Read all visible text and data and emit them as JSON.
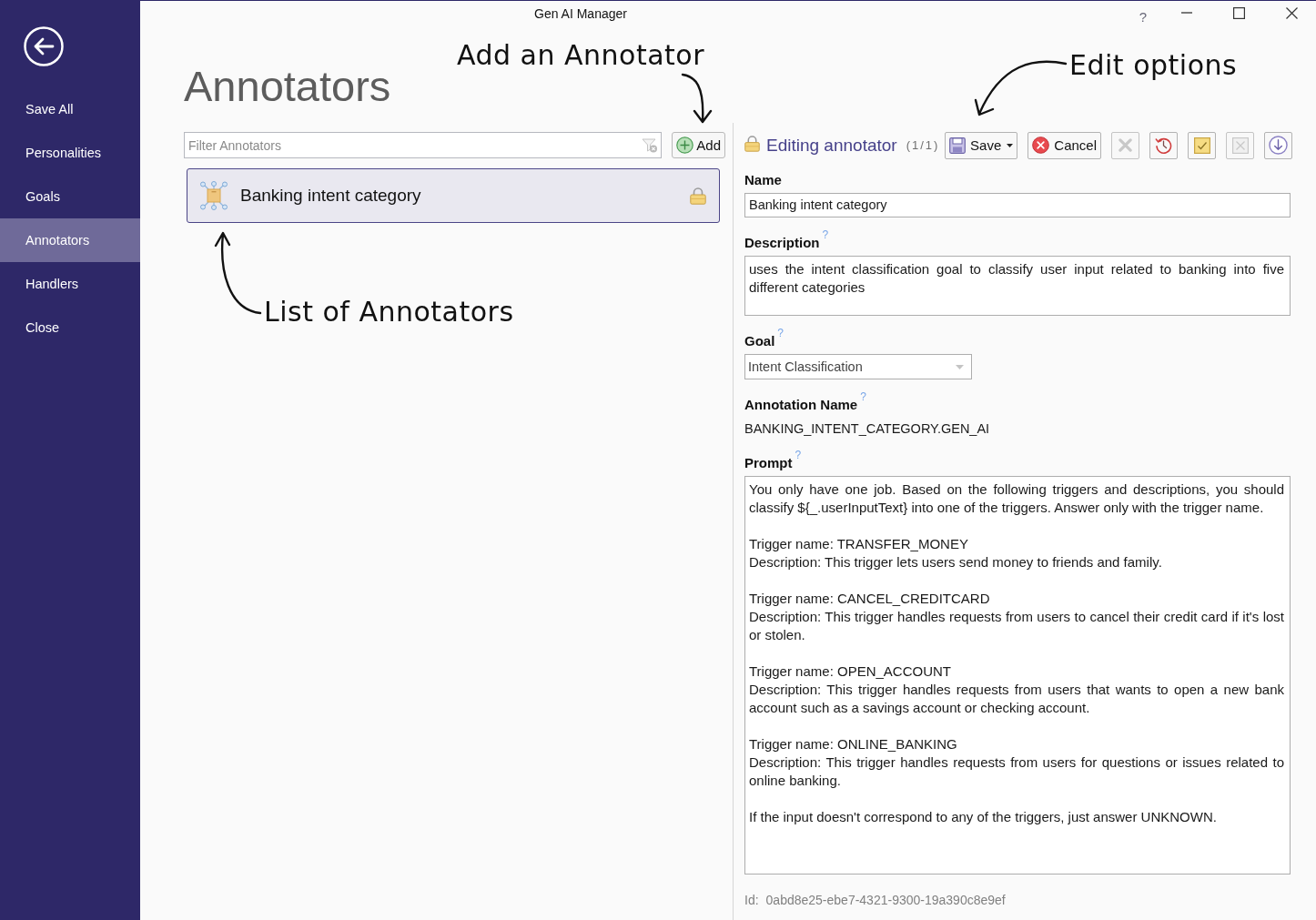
{
  "window": {
    "title": "Gen AI Manager",
    "help": "?"
  },
  "sidebar": {
    "items": [
      {
        "label": "Save All",
        "selected": false
      },
      {
        "label": "Personalities",
        "selected": false
      },
      {
        "label": "Goals",
        "selected": false
      },
      {
        "label": "Annotators",
        "selected": true
      },
      {
        "label": "Handlers",
        "selected": false
      },
      {
        "label": "Close",
        "selected": false
      }
    ]
  },
  "annotators_panel": {
    "title": "Annotators",
    "filter": {
      "placeholder": "Filter Annotators"
    },
    "add_button": "Add",
    "items": [
      {
        "label": "Banking intent category",
        "selected": true,
        "locked": true
      }
    ]
  },
  "editor": {
    "title": "Editing annotator",
    "counter": "(1/1)",
    "locked": true,
    "toolbar": [
      {
        "kind": "labeled",
        "label": "Save",
        "dropdown": true,
        "disabled": false
      },
      {
        "kind": "labeled",
        "label": "Cancel",
        "dropdown": false,
        "disabled": false
      },
      {
        "kind": "icon",
        "disabled": true
      },
      {
        "kind": "icon",
        "disabled": false
      },
      {
        "kind": "icon",
        "disabled": false
      },
      {
        "kind": "icon",
        "disabled": true
      },
      {
        "kind": "icon",
        "disabled": false
      }
    ],
    "fields": [
      {
        "kind": "input",
        "label": "Name",
        "value": "Banking intent category"
      },
      {
        "kind": "textarea",
        "label": "Description",
        "help": "?",
        "value": "uses the intent classification goal to classify user input related to banking into five different categories"
      },
      {
        "kind": "dropdown",
        "label": "Goal",
        "help": "?",
        "value": "Intent Classification"
      },
      {
        "kind": "readonly",
        "label": "Annotation Name",
        "help": "?",
        "value": "BANKING_INTENT_CATEGORY.GEN_AI"
      },
      {
        "kind": "textarea",
        "label": "Prompt",
        "help": "?",
        "value": "You only have one job. Based on the following triggers and descriptions, you should classify ${_.userInputText} into one of the triggers. Answer only with the trigger name.\n\nTrigger name: TRANSFER_MONEY\nDescription: This trigger lets users send money to friends and family.\n\nTrigger name: CANCEL_CREDITCARD\nDescription: This trigger handles requests from users to cancel their credit card if it's lost or stolen.\n\nTrigger name: OPEN_ACCOUNT\nDescription: This trigger handles requests from users that wants to open a new bank account such as a savings account or checking account.\n\nTrigger name: ONLINE_BANKING\nDescription: This trigger handles requests from users for questions or issues related to online banking.\n\nIf the input doesn't correspond to any of the triggers, just answer UNKNOWN."
      }
    ],
    "id": {
      "label": "Id:",
      "value": "0abd8e25-ebe7-4321-9300-19a390c8e9ef"
    }
  },
  "callouts": [
    {
      "text": "Add an Annotator"
    },
    {
      "text": "Edit options"
    },
    {
      "text": "List of Annotators"
    }
  ]
}
